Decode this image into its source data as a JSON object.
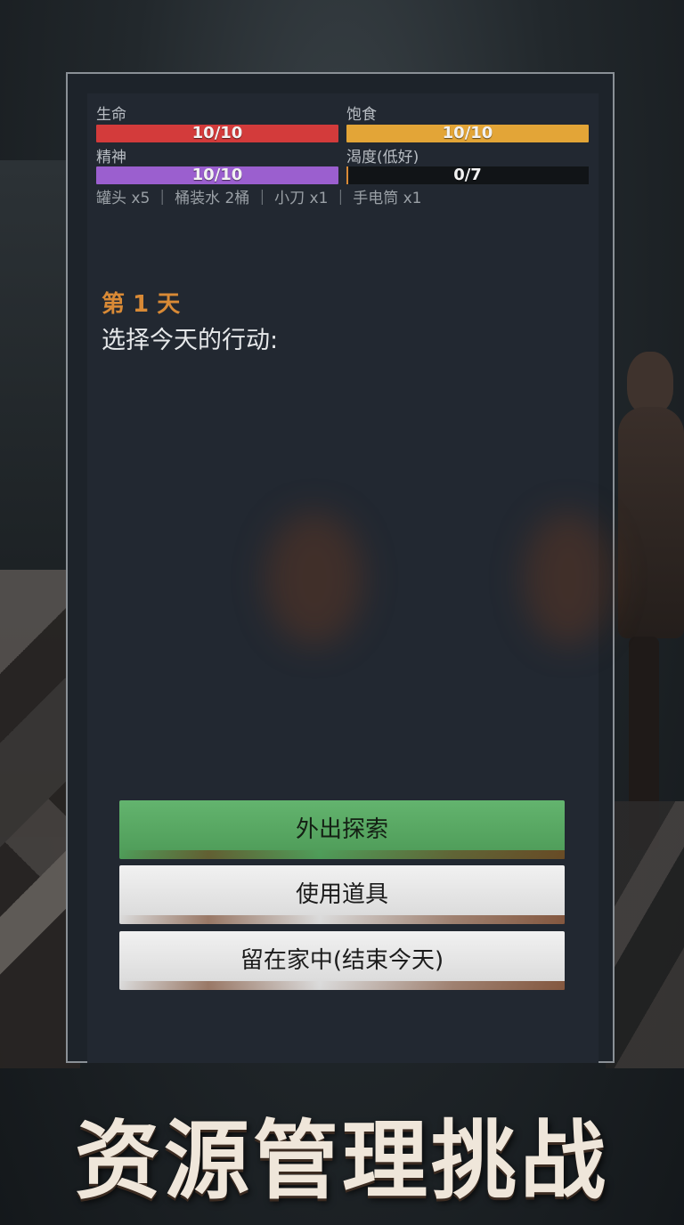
{
  "stats": {
    "health": {
      "label": "生命",
      "value": "10/10",
      "fraction": 1.0,
      "color": "#d33b3b"
    },
    "hunger": {
      "label": "饱食",
      "value": "10/10",
      "fraction": 1.0,
      "color": "#e3a537"
    },
    "spirit": {
      "label": "精神",
      "value": "10/10",
      "fraction": 1.0,
      "color": "#9b5fcf"
    },
    "thirst": {
      "label": "渴度(低好)",
      "value": "0/7",
      "fraction": 0.0,
      "color": "#d98a36"
    }
  },
  "inventory": "罐头 x5 ｜ 桶装水 2桶 ｜ 小刀 x1 ｜ 手电筒 x1",
  "day_title": "第 1 天",
  "prompt": "选择今天的行动:",
  "buttons": {
    "explore": "外出探索",
    "use_item": "使用道具",
    "stay_home": "留在家中(结束今天)"
  },
  "banner": "资源管理挑战"
}
